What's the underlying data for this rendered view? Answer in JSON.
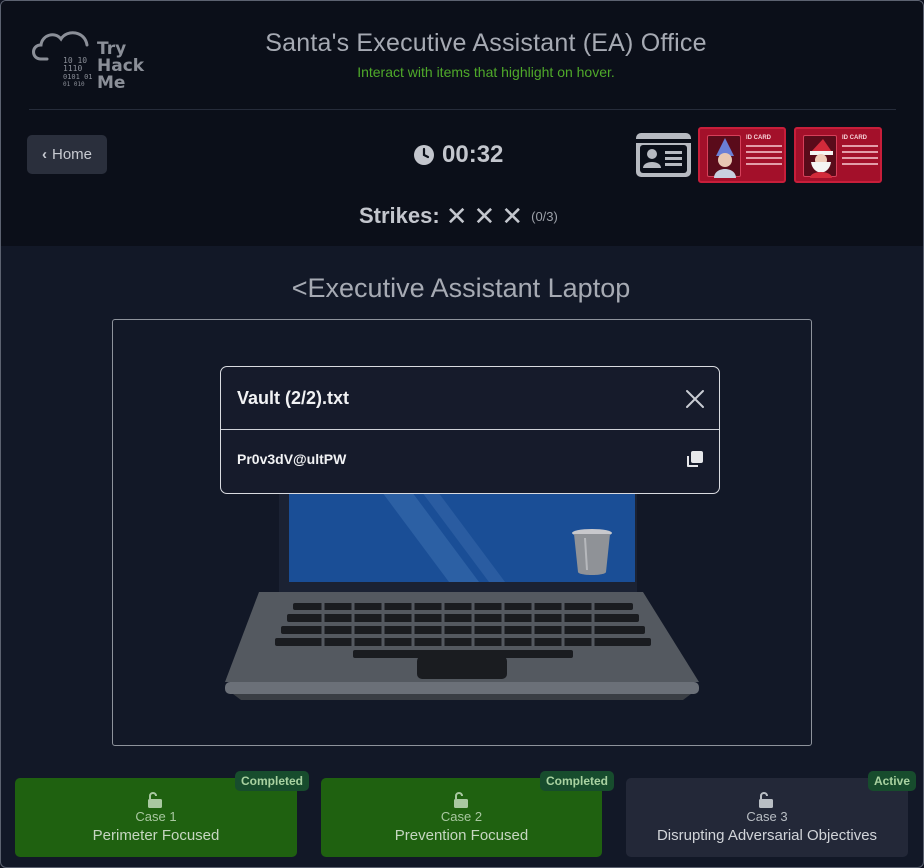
{
  "logo": {
    "lines": [
      "Try",
      "Hack",
      "Me"
    ],
    "binary": [
      "10 10",
      "1110",
      "0101 01",
      "01  010"
    ]
  },
  "header": {
    "title": "Santa's Executive Assistant (EA) Office",
    "subtitle": "Interact with items that highlight on hover."
  },
  "nav": {
    "home_label": "Home"
  },
  "timer": {
    "value": "00:32",
    "icon": "clock-icon"
  },
  "strikes": {
    "label": "Strikes:",
    "marks": [
      "✕",
      "✕",
      "✕"
    ],
    "count": "(0/3)"
  },
  "id_cards": [
    {
      "header": "ID CARD",
      "icon": "id-card-icon"
    },
    {
      "header": "ID CARD"
    },
    {
      "header": "ID CARD"
    }
  ],
  "section": {
    "back_label": "<Executive Assistant Laptop"
  },
  "modal": {
    "title": "Vault (2/2).txt",
    "content": "Pr0v3dV@ultPW",
    "close_icon": "close-icon",
    "copy_icon": "copy-icon"
  },
  "cases": [
    {
      "number": "Case 1",
      "name": "Perimeter Focused",
      "status": "Completed",
      "icon": "unlock-icon"
    },
    {
      "number": "Case 2",
      "name": "Prevention Focused",
      "status": "Completed",
      "icon": "unlock-icon"
    },
    {
      "number": "Case 3",
      "name": "Disrupting Adversarial Objectives",
      "status": "Active",
      "icon": "unlock-icon"
    }
  ],
  "colors": {
    "completed_bg": "#1f6110",
    "active_bg": "#232838",
    "accent_green": "#4fa92a",
    "card_red": "#a3102a"
  }
}
